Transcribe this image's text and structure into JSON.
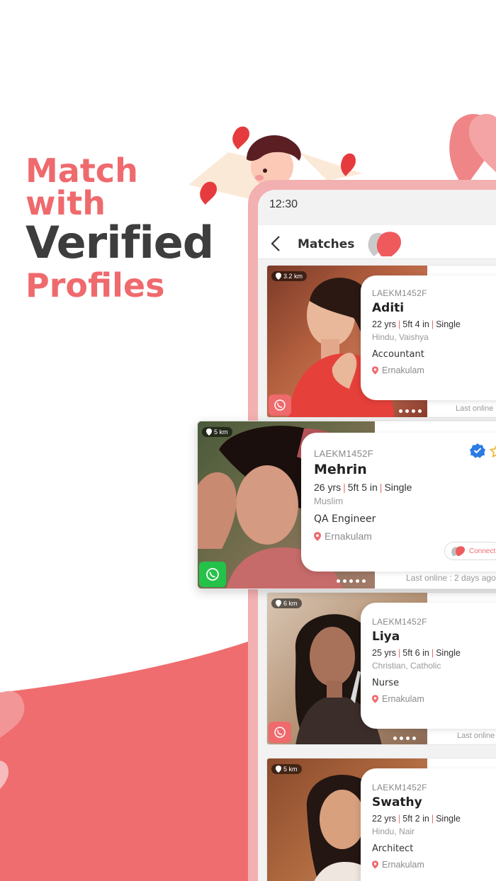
{
  "headline": {
    "line1": "Match",
    "line2": "with",
    "line3": "Verified",
    "line4": "Profiles"
  },
  "colors": {
    "accent": "#ef6a6d",
    "dark": "#3d3d3d",
    "whatsapp": "#25c24a"
  },
  "phone": {
    "time": "12:30",
    "title": "Matches"
  },
  "cards": [
    {
      "distance": "3.2 km",
      "id": "LAEKM1452F",
      "name": "Aditi",
      "age": "22 yrs",
      "height": "5ft 4 in",
      "status": "Single",
      "religion": "Hindu, Vaishya",
      "job": "Accountant",
      "location": "Ernakulam",
      "last_online": "Last online"
    },
    {
      "distance": "5 km",
      "id": "LAEKM1452F",
      "name": "Mehrin",
      "age": "26 yrs",
      "height": "5ft 5 in",
      "status": "Single",
      "religion": "Muslim",
      "job": "QA Engineer",
      "location": "Ernakulam",
      "connect": "Connect",
      "last_online": "Last online : 2 days ago"
    },
    {
      "distance": "6 km",
      "id": "LAEKM1452F",
      "name": "Liya",
      "age": "25 yrs",
      "height": "5ft 6 in",
      "status": "Single",
      "religion": "Christian, Catholic",
      "job": "Nurse",
      "location": "Ernakulam",
      "last_online": "Last online"
    },
    {
      "distance": "5 km",
      "id": "LAEKM1452F",
      "name": "Swathy",
      "age": "22 yrs",
      "height": "5ft 2 in",
      "status": "Single",
      "religion": "Hindu, Nair",
      "job": "Architect",
      "location": "Ernakulam"
    }
  ]
}
